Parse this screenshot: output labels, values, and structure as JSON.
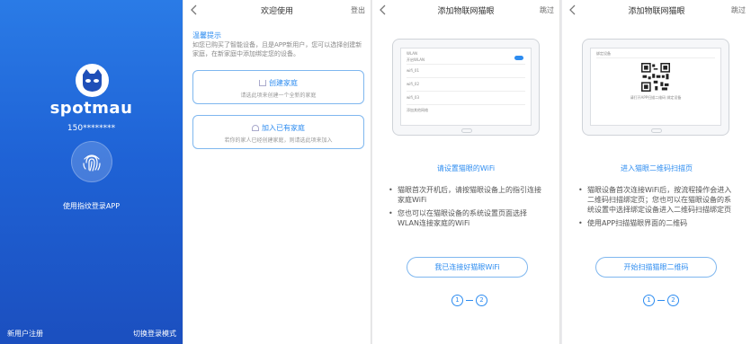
{
  "login": {
    "brand": "spotmau",
    "phone": "150********",
    "fingerprint_label": "使用指纹登录APP",
    "register": "新用户注册",
    "switch_mode": "切换登录模式"
  },
  "welcome": {
    "title": "欢迎使用",
    "logout": "登出",
    "tip_title": "温馨提示",
    "tip_text": "如您已购买了智能设备，且是APP新用户，您可以选择创建新家庭，在新家庭中添加绑定您的设备。",
    "create": {
      "title": "创建家庭",
      "subtitle": "请选此项来创建一个全新的家庭"
    },
    "join": {
      "title": "加入已有家庭",
      "subtitle": "若你的家人已经创建家庭，则请选此项来加入"
    }
  },
  "wifi_guide": {
    "title": "添加物联网猫眼",
    "skip": "跳过",
    "heading": "请设置猫眼的WiFi",
    "steps": [
      "猫眼首次开机后，请按猫眼设备上的指引连接家庭WiFi",
      "您也可以在猫眼设备的系统设置页面选择WLAN连接家庭的WiFi"
    ],
    "button": "我已连接好猫眼WiFi",
    "step1": "1",
    "step2": "2",
    "mock": {
      "header": "WLAN",
      "on_label": "开启WLAN",
      "net1": "wifi_01",
      "net2": "wifi_02",
      "net3": "wifi_03",
      "net4": "添加其他网络"
    }
  },
  "qr_guide": {
    "title": "添加物联网猫眼",
    "skip": "跳过",
    "heading": "进入猫眼二维码扫描页",
    "steps": [
      "猫眼设备首次连接WiFi后，按流程操作会进入二维码扫描绑定页；您也可以在猫眼设备的系统设置中选择绑定设备进入二维码扫描绑定页",
      "使用APP扫描猫眼界面的二维码"
    ],
    "button": "开始扫描猫眼二维码",
    "step1": "1",
    "step2": "2",
    "mock": {
      "header": "绑定设备",
      "caption": "请打开APP扫描二维码 绑定设备"
    }
  },
  "colors": {
    "accent": "#2d8cf0",
    "login_bg": "#1f63d6"
  }
}
